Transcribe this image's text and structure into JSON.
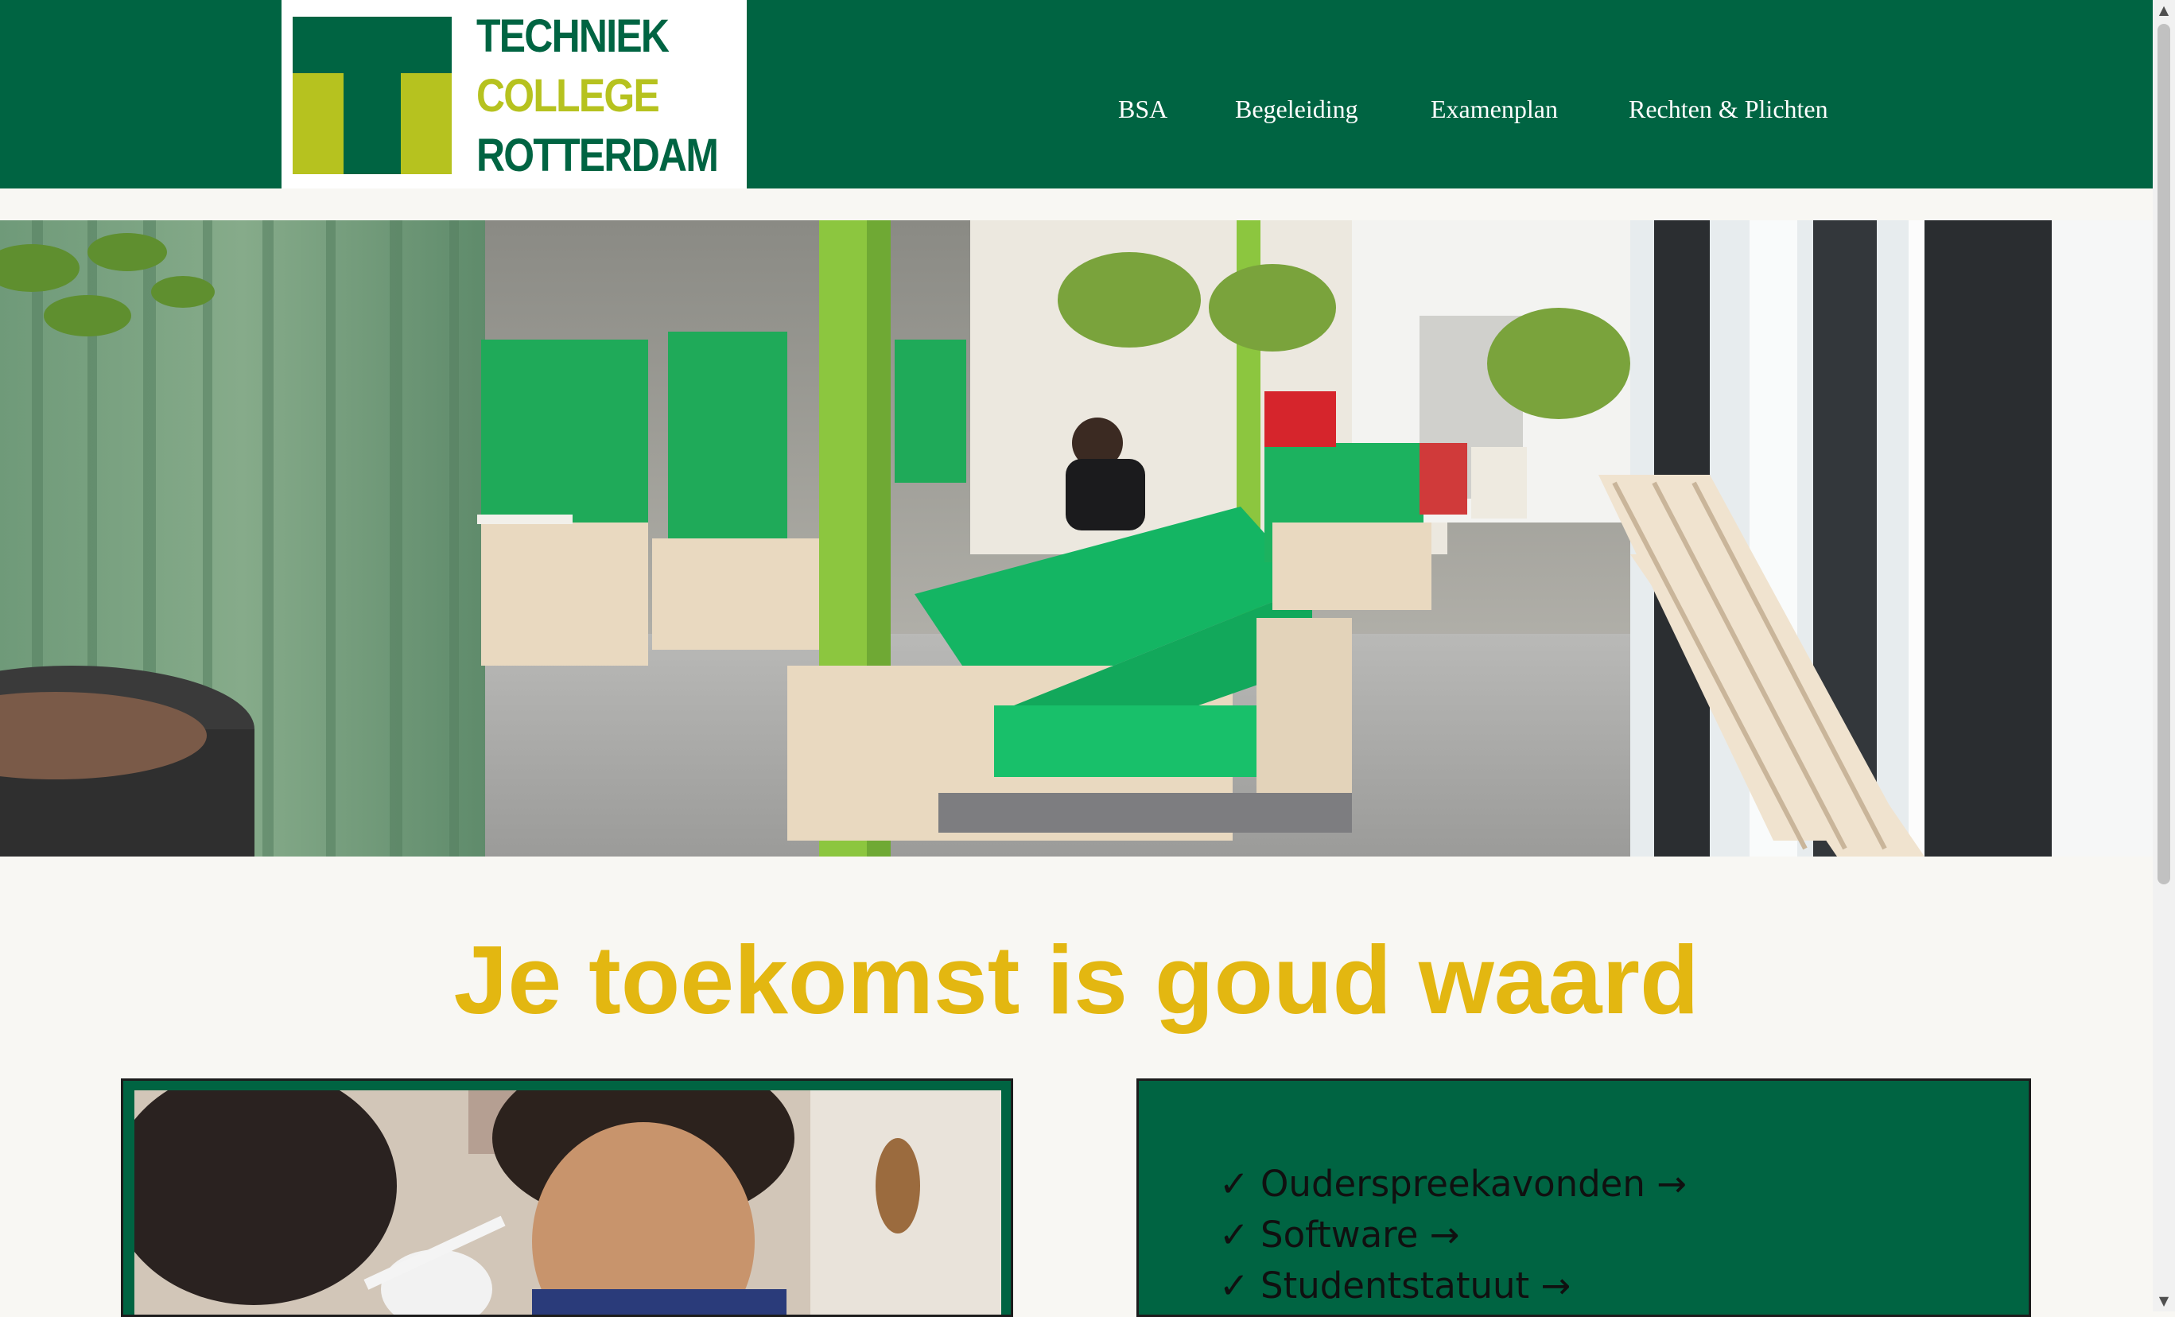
{
  "logo": {
    "line1": "TECHNIEK",
    "line2": "COLLEGE",
    "line3": "ROTTERDAM"
  },
  "nav": {
    "items": [
      {
        "label": "BSA"
      },
      {
        "label": "Begeleiding"
      },
      {
        "label": "Examenplan"
      },
      {
        "label": "Rechten & Plichten"
      }
    ]
  },
  "headline": "Je toekomst is goud waard",
  "links": [
    {
      "label": "✓ Ouderspreekavonden →"
    },
    {
      "label": "✓ Software →"
    },
    {
      "label": "✓ Studentstatuut →"
    }
  ],
  "scrollbar": {
    "up": "▲",
    "down": "▼"
  },
  "colors": {
    "brand_green": "#006442",
    "brand_lime": "#b6c21f",
    "headline_gold": "#e3b711",
    "page_background": "#f8f7f3"
  }
}
